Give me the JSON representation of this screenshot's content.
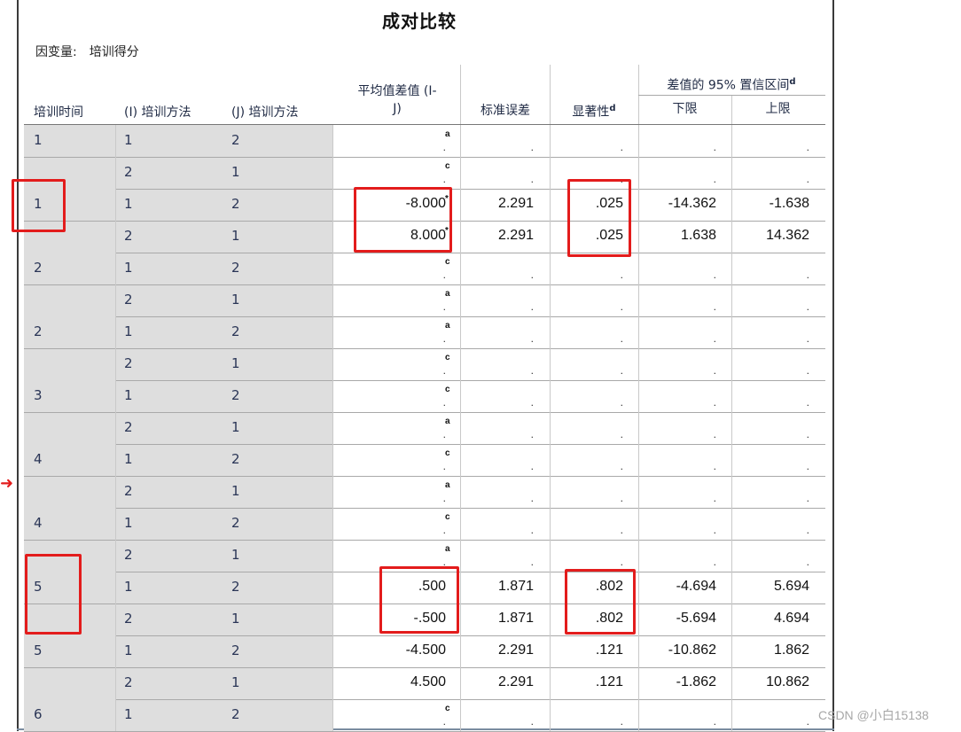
{
  "title": "成对比较",
  "dependent_label": "因变量:",
  "dependent_value": "培训得分",
  "headers": {
    "time": "培训时间",
    "method_i": "(I) 培训方法",
    "method_j": "(J) 培训方法",
    "mean_diff_line1": "平均值差值 (I-",
    "mean_diff_line2": "J)",
    "std_err": "标准误差",
    "sig": "显著性",
    "sig_sup": "d",
    "ci": "差值的 95% 置信区间",
    "ci_sup": "d",
    "lower": "下限",
    "upper": "上限"
  },
  "rows": [
    {
      "time": "1",
      "i": "1",
      "j": "2",
      "diff": ".",
      "diff_note": "a",
      "se": ".",
      "sig": ".",
      "lo": ".",
      "hi": "."
    },
    {
      "time": "",
      "i": "2",
      "j": "1",
      "diff": ".",
      "diff_note": "c",
      "se": ".",
      "sig": ".",
      "lo": ".",
      "hi": "."
    },
    {
      "time": "1",
      "i": "1",
      "j": "2",
      "diff": "-8.000",
      "diff_note": "*",
      "se": "2.291",
      "sig": ".025",
      "lo": "-14.362",
      "hi": "-1.638"
    },
    {
      "time": "",
      "i": "2",
      "j": "1",
      "diff": "8.000",
      "diff_note": "*",
      "se": "2.291",
      "sig": ".025",
      "lo": "1.638",
      "hi": "14.362"
    },
    {
      "time": "2",
      "i": "1",
      "j": "2",
      "diff": ".",
      "diff_note": "c",
      "se": ".",
      "sig": ".",
      "lo": ".",
      "hi": "."
    },
    {
      "time": "",
      "i": "2",
      "j": "1",
      "diff": ".",
      "diff_note": "a",
      "se": ".",
      "sig": ".",
      "lo": ".",
      "hi": "."
    },
    {
      "time": "2",
      "i": "1",
      "j": "2",
      "diff": ".",
      "diff_note": "a",
      "se": ".",
      "sig": ".",
      "lo": ".",
      "hi": "."
    },
    {
      "time": "",
      "i": "2",
      "j": "1",
      "diff": ".",
      "diff_note": "c",
      "se": ".",
      "sig": ".",
      "lo": ".",
      "hi": "."
    },
    {
      "time": "3",
      "i": "1",
      "j": "2",
      "diff": ".",
      "diff_note": "c",
      "se": ".",
      "sig": ".",
      "lo": ".",
      "hi": "."
    },
    {
      "time": "",
      "i": "2",
      "j": "1",
      "diff": ".",
      "diff_note": "a",
      "se": ".",
      "sig": ".",
      "lo": ".",
      "hi": "."
    },
    {
      "time": "4",
      "i": "1",
      "j": "2",
      "diff": ".",
      "diff_note": "c",
      "se": ".",
      "sig": ".",
      "lo": ".",
      "hi": "."
    },
    {
      "time": "",
      "i": "2",
      "j": "1",
      "diff": ".",
      "diff_note": "a",
      "se": ".",
      "sig": ".",
      "lo": ".",
      "hi": "."
    },
    {
      "time": "4",
      "i": "1",
      "j": "2",
      "diff": ".",
      "diff_note": "c",
      "se": ".",
      "sig": ".",
      "lo": ".",
      "hi": "."
    },
    {
      "time": "",
      "i": "2",
      "j": "1",
      "diff": ".",
      "diff_note": "a",
      "se": ".",
      "sig": ".",
      "lo": ".",
      "hi": "."
    },
    {
      "time": "5",
      "i": "1",
      "j": "2",
      "diff": ".500",
      "diff_note": "",
      "se": "1.871",
      "sig": ".802",
      "lo": "-4.694",
      "hi": "5.694"
    },
    {
      "time": "",
      "i": "2",
      "j": "1",
      "diff": "-.500",
      "diff_note": "",
      "se": "1.871",
      "sig": ".802",
      "lo": "-5.694",
      "hi": "4.694"
    },
    {
      "time": "5",
      "i": "1",
      "j": "2",
      "diff": "-4.500",
      "diff_note": "",
      "se": "2.291",
      "sig": ".121",
      "lo": "-10.862",
      "hi": "1.862"
    },
    {
      "time": "",
      "i": "2",
      "j": "1",
      "diff": "4.500",
      "diff_note": "",
      "se": "2.291",
      "sig": ".121",
      "lo": "-1.862",
      "hi": "10.862"
    },
    {
      "time": "6",
      "i": "1",
      "j": "2",
      "diff": ".",
      "diff_note": "c",
      "se": ".",
      "sig": ".",
      "lo": ".",
      "hi": "."
    }
  ],
  "watermark": "CSDN @小白15138",
  "colors": {
    "highlight": "#e31c1c",
    "shade": "#dedede",
    "header_text": "#1f2a44"
  }
}
